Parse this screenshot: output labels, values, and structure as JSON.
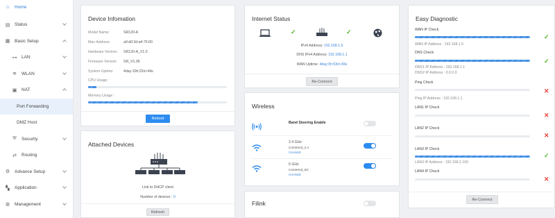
{
  "sidebar": {
    "home": "Home",
    "status": "Status",
    "basic_setup": "Basic Setup",
    "lan": "LAN",
    "wlan": "WLAN",
    "nat": "NAT",
    "port_forwarding": "Port Forwarding",
    "dmz_host": "DMZ Host",
    "security": "Security",
    "routing": "Routing",
    "advance_setup": "Advance Setup",
    "application": "Application",
    "management": "Management"
  },
  "device_info": {
    "title": "Device Infomation",
    "rows": [
      {
        "label": "Model Name:",
        "value": "SR120-A"
      },
      {
        "label": "Mac-Address:",
        "value": "a0:d0:3d:a4:75:00"
      },
      {
        "label": "Hardware Version:",
        "value": "SR120-A_V1.0"
      },
      {
        "label": "Firmware Version:",
        "value": "SR_V1.06"
      },
      {
        "label": "System Uptime:",
        "value": "4day:10h:22m:44s"
      }
    ],
    "cpu_label": "CPU Usage :",
    "cpu_usage_pct": 6,
    "memory_label": "Memory Usage :",
    "memory_usage_pct": 79,
    "reboot": "Reboot"
  },
  "attached": {
    "title": "Attached Devices",
    "link_text": "Link to DHCP client",
    "count_label": "Number of devices :",
    "count": "0",
    "refresh": "Refresh"
  },
  "internet": {
    "title": "Internet Status",
    "ipv4_label": "IPv4 Address:",
    "ipv4": "192.168.1.5",
    "dns_label": "DNS IPv4 Address:",
    "dns": "192.168.1.1",
    "wan_label": "WAN Uptime:",
    "wan_uptime": "4day:0h:53m:49s",
    "reconnect": "Re-Connect"
  },
  "wireless": {
    "title": "Wireless",
    "band_steering": "Band Steering Enable",
    "band_steering_on": false,
    "radios": [
      {
        "band": "2.4 GHz",
        "ssid": "Comtrend_2.4",
        "change": "CHANGE",
        "on": true
      },
      {
        "band": "5 GHz",
        "ssid": "Comtrend_5G",
        "change": "CHANGE",
        "on": true
      }
    ]
  },
  "filink": {
    "title": "Filink",
    "on": false
  },
  "diagnostic": {
    "title": "Easy Diagnostic",
    "wan_ip_check": "WAN IP Check",
    "wan_ip_line": "WAN IP Address : 192.168.1.5",
    "dns_check": "DNS Check",
    "dns1_line": "DNS1 IP Address : 192.168.1.1",
    "dns2_line": "DNS2 IP Address : 0.0.0.0",
    "ping_check": "Ping Check",
    "ping_line": "Ping IP Address : 192.168.1.1",
    "lan1_check": "LAN1 IP Check",
    "lan2_check": "LAN2 IP Check",
    "lan3_check": "LAN3 IP Check",
    "lan3_line": "LAN3 IP Address : 192.168.2.100",
    "lan4_check": "LAN4 IP Check",
    "reconnect": "Re-Connect"
  },
  "colors": {
    "accent": "#2d8cf0",
    "ok": "#52b32a",
    "fail": "#e9403c"
  }
}
